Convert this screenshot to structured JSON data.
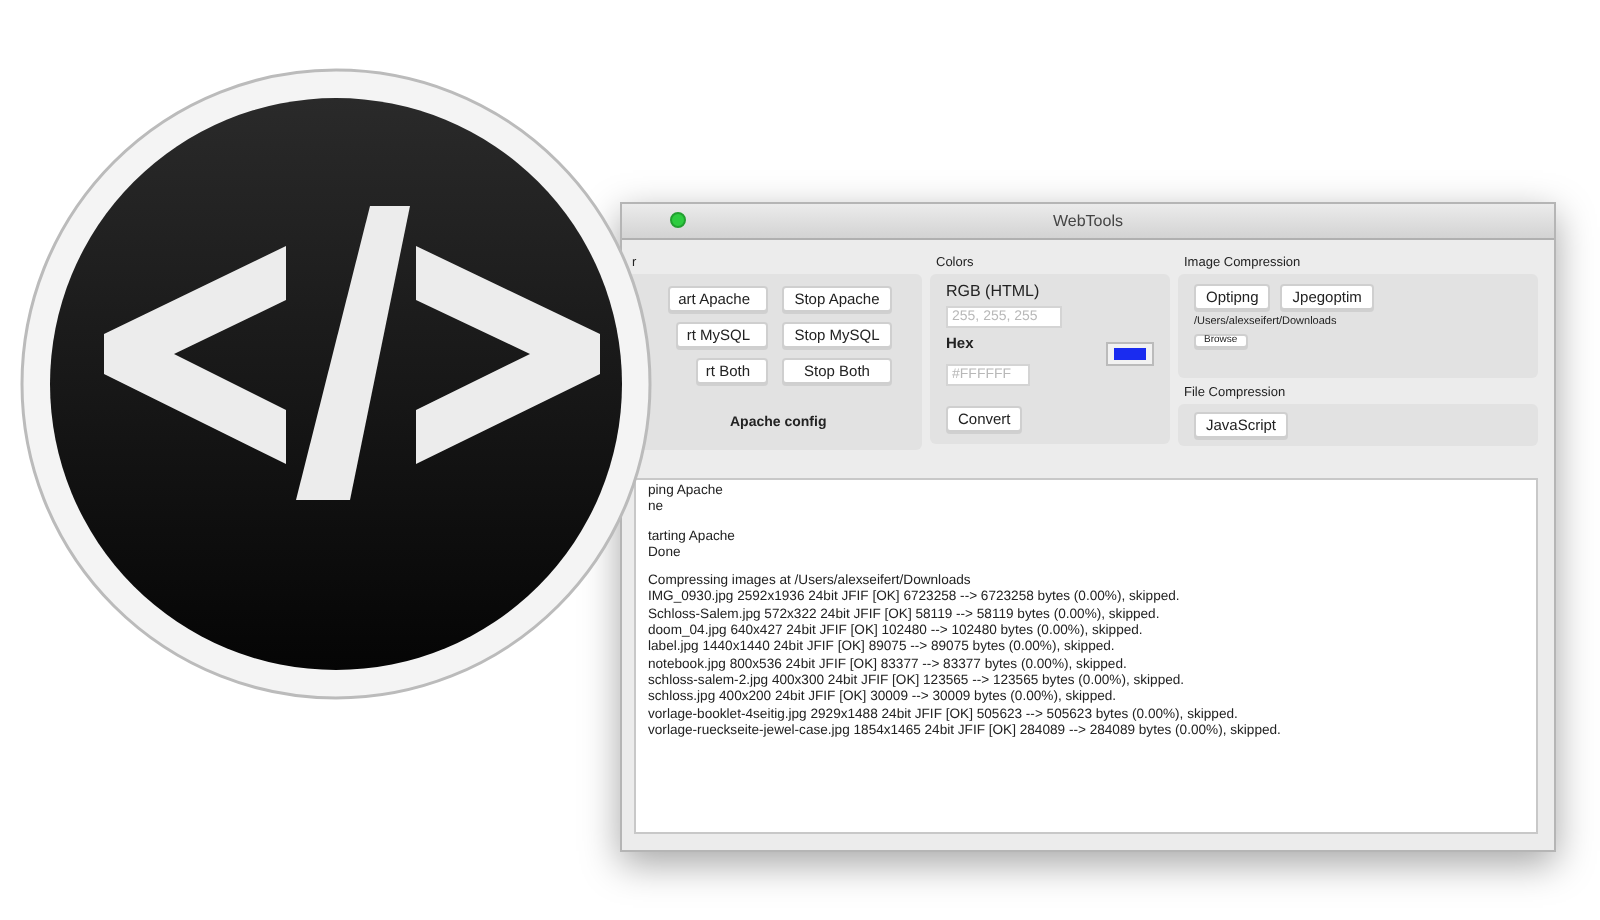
{
  "window": {
    "title": "WebTools"
  },
  "server": {
    "label": "r",
    "buttons": [
      "art Apache",
      "Stop Apache",
      "rt MySQL",
      "Stop MySQL",
      "rt Both",
      "Stop Both"
    ],
    "config_label": "Apache config"
  },
  "colors": {
    "label": "Colors",
    "rgb_label": "RGB (HTML)",
    "rgb_field": {
      "placeholder": "255, 255, 255"
    },
    "hex_label": "Hex",
    "hex_field": {
      "placeholder": "#FFFFFF"
    },
    "swatch": {
      "color": "#1a2cf0"
    },
    "button": "Convert"
  },
  "image_compression": {
    "label": "Image Compression",
    "buttons": [
      "Optipng",
      "Jpegoptim"
    ],
    "path": "/Users/alexseifert/Downloads",
    "browse": "Browse"
  },
  "file_compression": {
    "label": "File Compression",
    "buttons": [
      "JavaScript"
    ]
  },
  "log": {
    "blocks": [
      [
        "ping Apache",
        "ne"
      ],
      [
        "tarting Apache",
        "Done"
      ],
      [
        "Compressing images at /Users/alexseifert/Downloads",
        "IMG_0930.jpg 2592x1936 24bit JFIF  [OK] 6723258 --> 6723258 bytes (0.00%), skipped.",
        "Schloss-Salem.jpg 572x322 24bit JFIF  [OK] 58119 --> 58119 bytes (0.00%), skipped.",
        "doom_04.jpg 640x427 24bit JFIF  [OK] 102480 --> 102480 bytes (0.00%), skipped.",
        "label.jpg 1440x1440 24bit JFIF  [OK] 89075 --> 89075 bytes (0.00%), skipped.",
        "notebook.jpg 800x536 24bit JFIF  [OK] 83377 --> 83377 bytes (0.00%), skipped.",
        "schloss-salem-2.jpg 400x300 24bit JFIF  [OK] 123565 --> 123565 bytes (0.00%), skipped.",
        "schloss.jpg 400x200 24bit JFIF  [OK] 30009 --> 30009 bytes (0.00%), skipped.",
        "vorlage-booklet-4seitig.jpg 2929x1488 24bit JFIF  [OK] 505623 --> 505623 bytes (0.00%), skipped.",
        "vorlage-rueckseite-jewel-case.jpg 1854x1465 24bit JFIF  [OK] 284089 --> 284089 bytes (0.00%), skipped."
      ]
    ]
  }
}
